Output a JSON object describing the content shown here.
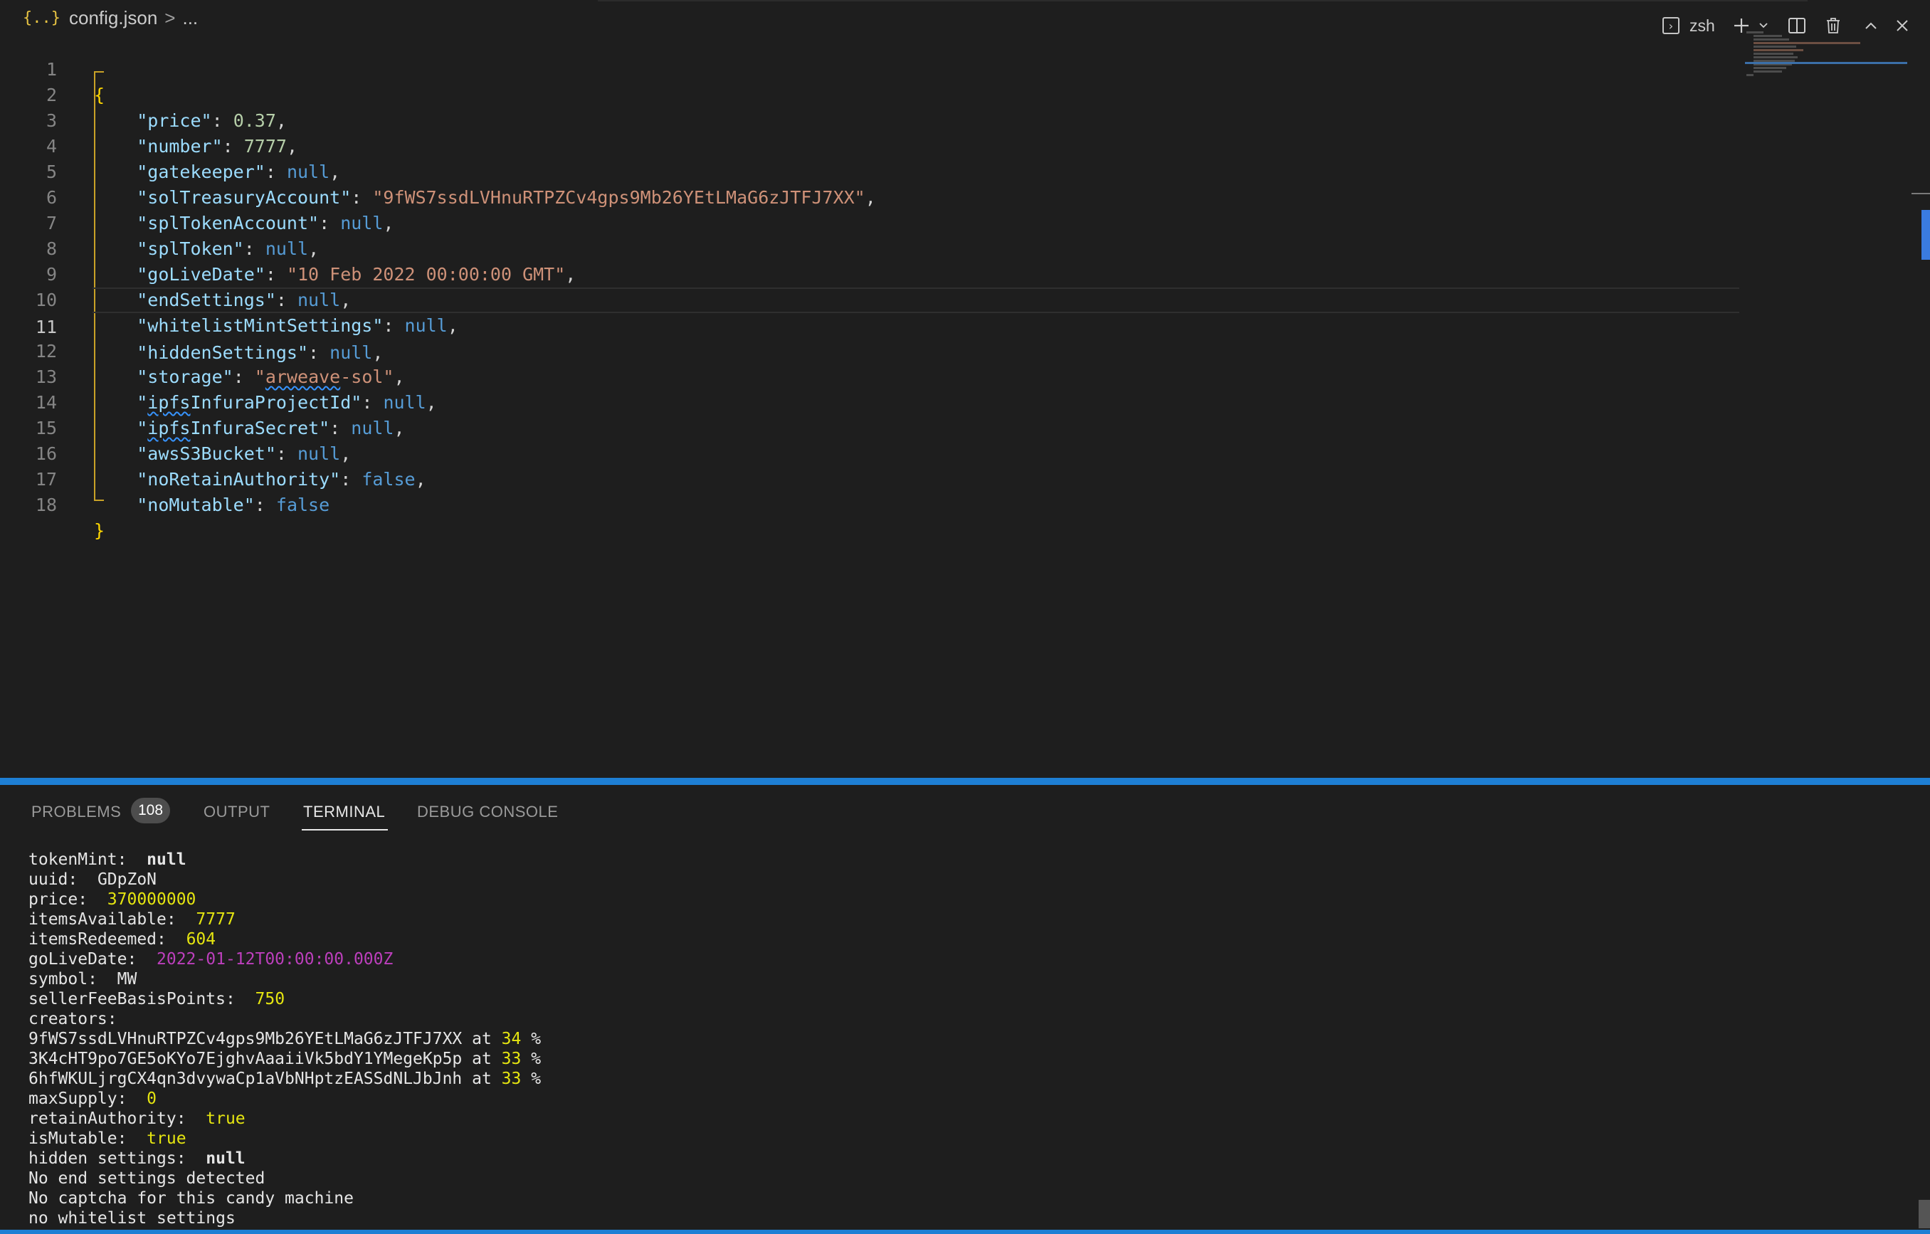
{
  "breadcrumb": {
    "icon": "json-braces-icon",
    "file": "config.json",
    "separator": ">",
    "more": "..."
  },
  "editor": {
    "current_line": 11,
    "lines": [
      {
        "n": "1"
      },
      {
        "n": "2"
      },
      {
        "n": "3"
      },
      {
        "n": "4"
      },
      {
        "n": "5"
      },
      {
        "n": "6"
      },
      {
        "n": "7"
      },
      {
        "n": "8"
      },
      {
        "n": "9"
      },
      {
        "n": "10"
      },
      {
        "n": "11"
      },
      {
        "n": "12"
      },
      {
        "n": "13"
      },
      {
        "n": "14"
      },
      {
        "n": "15"
      },
      {
        "n": "16"
      },
      {
        "n": "17"
      },
      {
        "n": "18"
      }
    ],
    "entries": {
      "open_brace": "{",
      "close_brace": "}",
      "price_key": "\"price\"",
      "price_val": "0.37",
      "number_key": "\"number\"",
      "number_val": "7777",
      "gatekeeper_key": "\"gatekeeper\"",
      "gatekeeper_val": "null",
      "solTreasury_key": "\"solTreasuryAccount\"",
      "solTreasury_val": "\"9fWS7ssdLVHnuRTPZCv4gps9Mb26YEtLMaG6zJTFJ7XX\"",
      "splTokenAccount_key": "\"splTokenAccount\"",
      "splTokenAccount_val": "null",
      "splToken_key": "\"splToken\"",
      "splToken_val": "null",
      "goLiveDate_key": "\"goLiveDate\"",
      "goLiveDate_val": "\"10 Feb 2022 00:00:00 GMT\"",
      "endSettings_key": "\"endSettings\"",
      "endSettings_val": "null",
      "whitelist_key": "\"whitelistMintSettings\"",
      "whitelist_val": "null",
      "hidden_key": "\"hiddenSettings\"",
      "hidden_val": "null",
      "storage_key": "\"storage\"",
      "storage_q1": "\"",
      "storage_a": "arweave",
      "storage_b": "-sol\"",
      "ipfsProj_q": "\"",
      "ipfsProj_a": "ipfs",
      "ipfsProj_b": "InfuraProjectId\"",
      "ipfsProj_val": "null",
      "ipfsSec_q": "\"",
      "ipfsSec_a": "ipfs",
      "ipfsSec_b": "InfuraSecret\"",
      "ipfsSec_val": "null",
      "aws_key": "\"awsS3Bucket\"",
      "aws_val": "null",
      "noRetain_key": "\"noRetainAuthority\"",
      "noRetain_val": "false",
      "noMutable_key": "\"noMutable\"",
      "noMutable_val": "false"
    }
  },
  "panel": {
    "tabs": {
      "problems": "PROBLEMS",
      "problems_count": "108",
      "output": "OUTPUT",
      "terminal": "TERMINAL",
      "debug": "DEBUG CONSOLE"
    },
    "shell": "zsh",
    "icons": {
      "terminal": "terminal-icon",
      "add": "plus-icon",
      "dropdown": "chevron-down-icon",
      "split": "split-icon",
      "trash": "trash-icon",
      "maximize": "chevron-up-icon",
      "close": "close-icon"
    }
  },
  "terminal": {
    "tokenMint_label": "tokenMint:  ",
    "tokenMint_val": "null",
    "uuid_label": "uuid:  ",
    "uuid_val": "GDpZoN",
    "price_label": "price:  ",
    "price_val": "370000000",
    "itemsAvailable_label": "itemsAvailable:  ",
    "itemsAvailable_val": "7777",
    "itemsRedeemed_label": "itemsRedeemed:  ",
    "itemsRedeemed_val": "604",
    "goLiveDate_label": "goLiveDate:  ",
    "goLiveDate_val": "2022-01-12T00:00:00.000Z",
    "symbol_label": "symbol:  ",
    "symbol_val": "MW",
    "sellerFee_label": "sellerFeeBasisPoints:  ",
    "sellerFee_val": "750",
    "creators_label": "creators:",
    "creator1_addr": "9fWS7ssdLVHnuRTPZCv4gps9Mb26YEtLMaG6zJTFJ7XX at ",
    "creator1_pct": "34",
    "creator1_suffix": " %",
    "creator2_addr": "3K4cHT9po7GE5oKYo7EjghvAaaiiVk5bdY1YMegeKp5p at ",
    "creator2_pct": "33",
    "creator2_suffix": " %",
    "creator3_addr": "6hfWKULjrgCX4qn3dvywaCp1aVbNHptzEASSdNLJbJnh at ",
    "creator3_pct": "33",
    "creator3_suffix": " %",
    "maxSupply_label": "maxSupply:  ",
    "maxSupply_val": "0",
    "retainAuthority_label": "retainAuthority:  ",
    "retainAuthority_val": "true",
    "isMutable_label": "isMutable:  ",
    "isMutable_val": "true",
    "hidden_label": "hidden settings:  ",
    "hidden_val": "null",
    "msg1": "No end settings detected",
    "msg2": "No captcha for this candy machine",
    "msg3": "no whitelist settings"
  },
  "colors": {
    "accent": "#1e7fd4",
    "json_key": "#9cdcfe",
    "json_string": "#ce9178",
    "json_number": "#b5cea8",
    "json_keyword": "#569cd6",
    "terminal_yellow": "#e5e510",
    "terminal_magenta": "#bc3fbc"
  }
}
